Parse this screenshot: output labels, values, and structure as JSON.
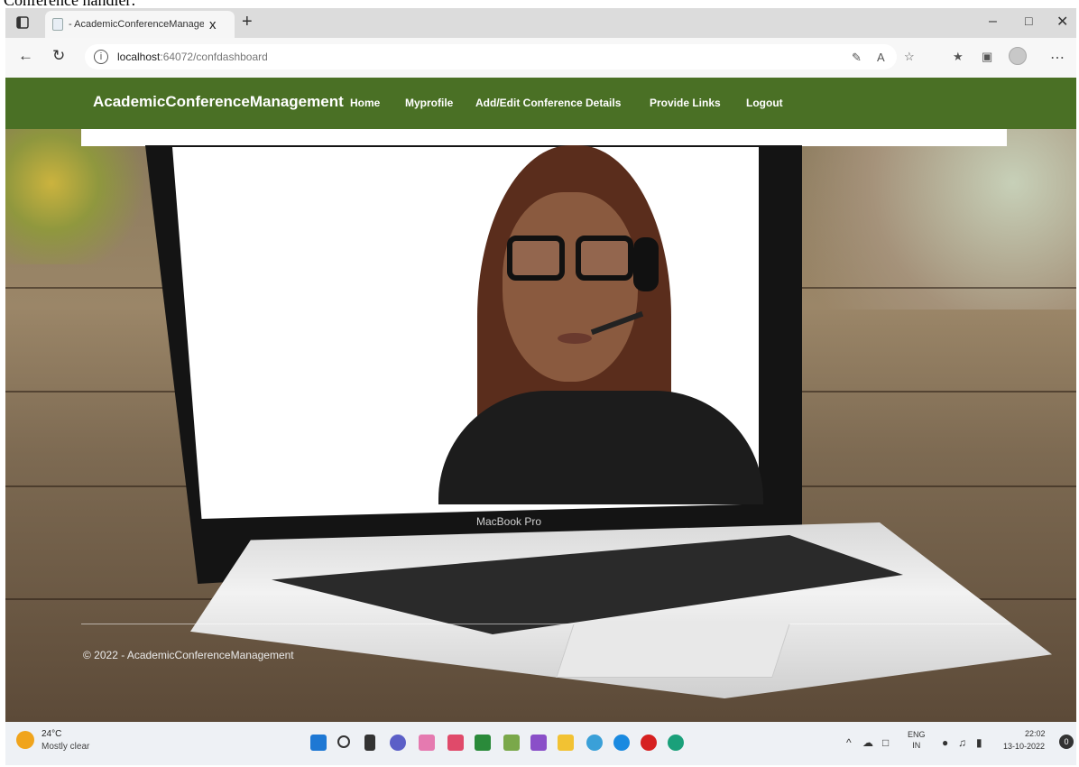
{
  "caption": "Conference handler:",
  "browser": {
    "tab_title": "- AcademicConferenceManagem",
    "tab_close": "x",
    "new_tab": "+",
    "window_controls": {
      "minimize": "–",
      "maximize": "□",
      "close": "✕"
    },
    "url_host": "localhost",
    "url_path": ":64072/confdashboard",
    "icons": [
      "tab-actions-icon",
      "back-icon",
      "refresh-icon",
      "site-info-icon",
      "read-aloud-icon",
      "text-size-icon",
      "favorite-add-icon",
      "favorites-icon",
      "collections-icon",
      "profile-icon",
      "more-icon"
    ]
  },
  "site": {
    "brand": "AcademicConferenceManagement",
    "nav": [
      "Home",
      "Myprofile",
      "Add/Edit Conference Details",
      "Provide Links",
      "Logout"
    ],
    "footer": "© 2022 - AcademicConferenceManagement",
    "header_color": "#4a7025",
    "hero_caption": "MacBook Pro"
  },
  "taskbar": {
    "weather": {
      "temp": "24°C",
      "desc": "Mostly clear"
    },
    "apps": [
      "start-icon",
      "search-icon",
      "task-view-icon",
      "teams-chat-icon",
      "snipping-tool-icon",
      "app-icon",
      "notepad-icon",
      "paint-icon",
      "visual-studio-icon",
      "file-explorer-icon",
      "settings-icon",
      "skype-icon",
      "record-icon",
      "edge-icon"
    ],
    "lang_1": "ENG",
    "lang_2": "IN",
    "time": "22:02",
    "date": "13-10-2022",
    "notifications": "0"
  }
}
